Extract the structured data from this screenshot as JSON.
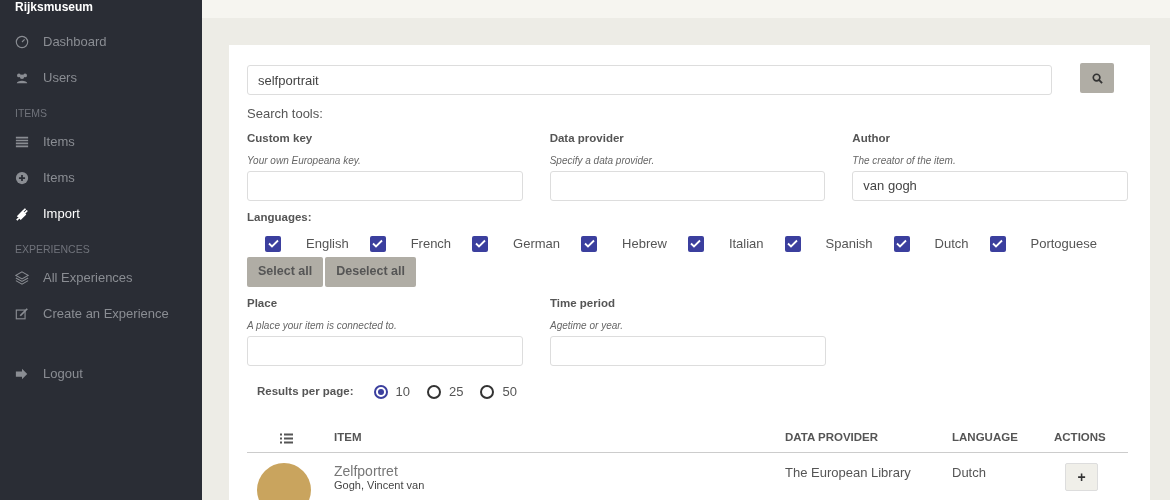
{
  "sidebar": {
    "brand": "Rijksmuseum",
    "sections": [
      {
        "items": [
          {
            "label": "Dashboard",
            "selected": false
          },
          {
            "label": "Users",
            "selected": false
          }
        ]
      },
      {
        "heading": "ITEMS",
        "items": [
          {
            "label": "Items",
            "selected": false
          },
          {
            "label": "Items",
            "selected": false
          },
          {
            "label": "Import",
            "selected": true
          }
        ]
      },
      {
        "heading": "EXPERIENCES",
        "items": [
          {
            "label": "All Experiences",
            "selected": false
          },
          {
            "label": "Create an Experience",
            "selected": false
          }
        ]
      },
      {
        "items": [
          {
            "label": "Logout",
            "selected": false
          }
        ]
      }
    ]
  },
  "search": {
    "value": "selfportrait",
    "tools_label": "Search tools:"
  },
  "fields": [
    {
      "label": "Custom key",
      "hint": "Your own Europeana key."
    },
    {
      "label": "Data provider",
      "hint": "Specify a data provider."
    },
    {
      "label": "Author",
      "hint": "The creator of the item.",
      "value": "van gogh"
    }
  ],
  "languages": {
    "label": "Languages:",
    "options": [
      {
        "label": "English",
        "checked": true
      },
      {
        "label": "French",
        "checked": true
      },
      {
        "label": "German",
        "checked": true
      },
      {
        "label": "Hebrew",
        "checked": true
      },
      {
        "label": "Italian",
        "checked": true
      },
      {
        "label": "Spanish",
        "checked": true
      },
      {
        "label": "Dutch",
        "checked": true
      },
      {
        "label": "Portoguese",
        "checked": true
      }
    ],
    "buttons": [
      "Select all",
      "Deselect all"
    ]
  },
  "fields_2": [
    {
      "label": "Place",
      "hint": "A place your item is connected to."
    },
    {
      "label": "Time period",
      "hint": "Agetime or year."
    }
  ],
  "results_per_page": {
    "label": "Results per page:",
    "options": [
      {
        "label": "10",
        "selected": true
      },
      {
        "label": "25",
        "selected": false
      },
      {
        "label": "50",
        "selected": false
      }
    ]
  },
  "table": {
    "columns": [
      "ITEM",
      "DATA PROVIDER",
      "LANGUAGE",
      "ACTIONS"
    ],
    "rows": [
      {
        "title": "Zelfportret",
        "author": "Gogh, Vincent van",
        "provider": "The European Library",
        "language": "Dutch",
        "action": "+"
      }
    ]
  }
}
